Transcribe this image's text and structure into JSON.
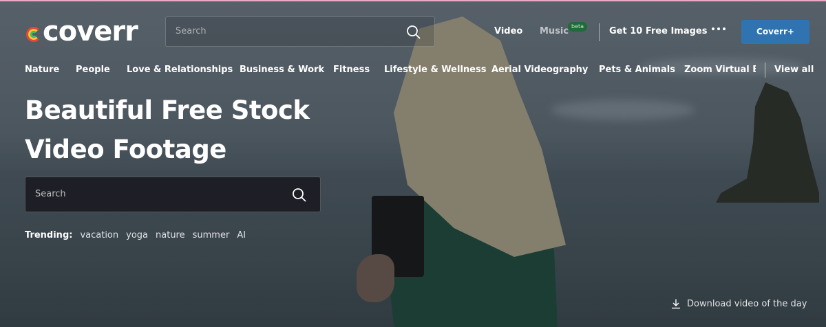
{
  "header": {
    "logo_text": "coverr",
    "search_placeholder": "Search",
    "nav": {
      "video": "Video",
      "music": "Music",
      "music_badge": "beta",
      "free_images": "Get 10 Free Images",
      "more_icon": "more-dots-icon",
      "cta": "Coverr+"
    }
  },
  "categories": [
    "Nature",
    "People",
    "Love & Relationships",
    "Business & Work",
    "Fitness",
    "Lifestyle & Wellness",
    "Aerial Videography",
    "Pets & Animals",
    "Zoom Virtual Bc"
  ],
  "view_all": "View all",
  "hero": {
    "title_line1": "Beautiful Free Stock",
    "title_line2": "Video Footage",
    "search_placeholder": "Search",
    "trending_label": "Trending:",
    "trending_tags": [
      "vacation",
      "yoga",
      "nature",
      "summer",
      "AI"
    ],
    "download_label": "Download video of the day"
  },
  "icons": {
    "search": "search-icon",
    "download": "download-icon"
  },
  "colors": {
    "cta": "#2f73b0",
    "beta_badge": "#1f6b3a",
    "search_box": "#1e1f26"
  }
}
